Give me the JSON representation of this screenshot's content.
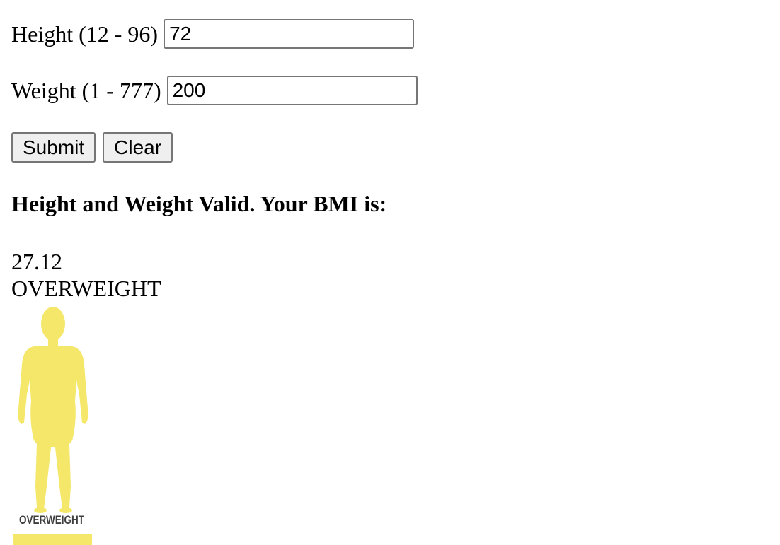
{
  "form": {
    "height_label": "Height (12 - 96)",
    "height_value": "72",
    "weight_label": "Weight (1 - 777)",
    "weight_value": "200",
    "submit_label": "Submit",
    "clear_label": "Clear"
  },
  "result": {
    "heading": "Height and Weight Valid. Your BMI is:",
    "bmi": "27.12",
    "category": "OVERWEIGHT",
    "image_caption": "OVERWEIGHT",
    "figure_color": "#f4e76a"
  }
}
